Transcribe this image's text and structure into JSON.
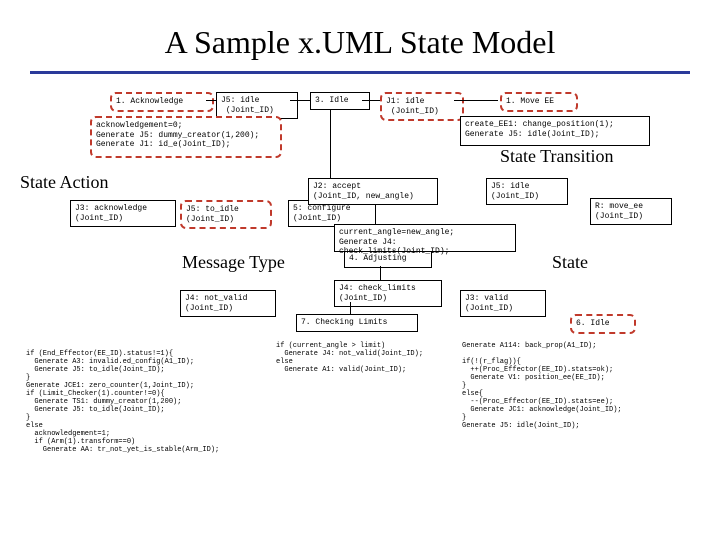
{
  "title": "A Sample x.UML State Model",
  "callouts": {
    "state_transition": "State Transition",
    "state_action": "State Action",
    "message_type": "Message Type",
    "state": "State"
  },
  "boxes": {
    "b1": "1. Acknowledge",
    "b2": "J5: idle\n (Joint_ID)",
    "b3": "3. Idle",
    "b4": "J1: idle\n (Joint_ID)",
    "b5": "1. Move EE",
    "b6": "J3: acknowledge\n(Joint_ID)",
    "b7": "J5: to_idle\n(Joint_ID)",
    "b8": "5: configure\n(Joint_ID)",
    "b9": "4. Adjusting",
    "b10": "J2: accept\n(Joint_ID, new_angle)",
    "b11": "J5: idle\n(Joint_ID)",
    "b12": "R: move_ee\n(Joint_ID)",
    "b13": "J4: not_valid\n(Joint_ID)",
    "b14": "J4: check_limits\n(Joint_ID)",
    "b15": "7. Checking Limits",
    "b16": "J3: valid\n(Joint_ID)",
    "b17": "6. Idle"
  },
  "actions": {
    "a1": "acknowledgement=0;\nGenerate J5: dummy_creator(1,200);\nGenerate J1: id_e(Joint_ID);",
    "a2": "create_EE1: change_position(1);\nGenerate J5: idle(Joint_ID);",
    "a3": "current_angle=new_angle;\nGenerate J4: check_limits(Joint_ID);"
  },
  "code": {
    "c1": "if (End_Effector(EE_ID).status!=1){\n  Generate A3: invalid.ed_config(A1_ID);\n  Generate J5: to_idle(Joint_ID);\n}\nGenerate JCE1: zero_counter(1,Joint_ID);\nif (Limit_Checker(1).counter!=0){\n  Generate TS1: dummy_creator(1,200);\n  Generate J5: to_idle(Joint_ID);\n}\nelse\n  acknowledgement=1;\n  if (Arm(1).transform==0)\n    Generate AA: tr_not_yet_is_stable(Arm_ID);",
    "c2": "if (current_angle > limit)\n  Generate J4: not_valid(Joint_ID);\nelse\n  Generate A1: valid(Joint_ID);",
    "c3": "Generate A114: back_prop(A1_ID);\n\nif(!(r_flag)){\n  ++(Proc_Effector(EE_ID).stats=ok);\n  Generate V1: position_ee(EE_ID);\n}\nelse{\n  --(Proc_Effector(EE_ID).stats=ee);\n  Generate JC1: acknowledge(Joint_ID);\n}\nGenerate J5: idle(Joint_ID);"
  }
}
